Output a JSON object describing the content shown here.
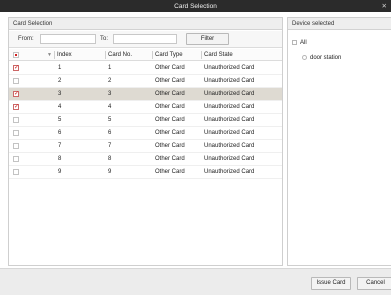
{
  "window": {
    "title": "Card Selection",
    "close_glyph": "✕"
  },
  "card_selection": {
    "header": "Card Selection",
    "filter": {
      "from_label": "From:",
      "to_label": "To:",
      "from_value": "",
      "to_value": "",
      "button_label": "Filter"
    },
    "columns": {
      "index": "Index",
      "card_no": "Card No.",
      "card_type": "Card Type",
      "card_state": "Card State"
    },
    "rows": [
      {
        "index": "1",
        "card_no": "1",
        "card_type": "Other Card",
        "card_state": "Unauthorized Card",
        "checked": true,
        "selected": false
      },
      {
        "index": "2",
        "card_no": "2",
        "card_type": "Other Card",
        "card_state": "Unauthorized Card",
        "checked": false,
        "selected": false
      },
      {
        "index": "3",
        "card_no": "3",
        "card_type": "Other Card",
        "card_state": "Unauthorized Card",
        "checked": true,
        "selected": true
      },
      {
        "index": "4",
        "card_no": "4",
        "card_type": "Other Card",
        "card_state": "Unauthorized Card",
        "checked": true,
        "selected": false
      },
      {
        "index": "5",
        "card_no": "5",
        "card_type": "Other Card",
        "card_state": "Unauthorized Card",
        "checked": false,
        "selected": false
      },
      {
        "index": "6",
        "card_no": "6",
        "card_type": "Other Card",
        "card_state": "Unauthorized Card",
        "checked": false,
        "selected": false
      },
      {
        "index": "7",
        "card_no": "7",
        "card_type": "Other Card",
        "card_state": "Unauthorized Card",
        "checked": false,
        "selected": false
      },
      {
        "index": "8",
        "card_no": "8",
        "card_type": "Other Card",
        "card_state": "Unauthorized Card",
        "checked": false,
        "selected": false
      },
      {
        "index": "9",
        "card_no": "9",
        "card_type": "Other Card",
        "card_state": "Unauthorized Card",
        "checked": false,
        "selected": false
      }
    ]
  },
  "device_selected": {
    "header": "Device selected",
    "all_label": "All",
    "devices": [
      {
        "label": "door station",
        "checked": false
      }
    ]
  },
  "footer": {
    "issue_card_label": "Issue Card",
    "cancel_label": "Cancel"
  },
  "colors": {
    "titlebar": "#2b2b2b",
    "selected_row": "#dedad2",
    "check_mark": "#d02020"
  }
}
